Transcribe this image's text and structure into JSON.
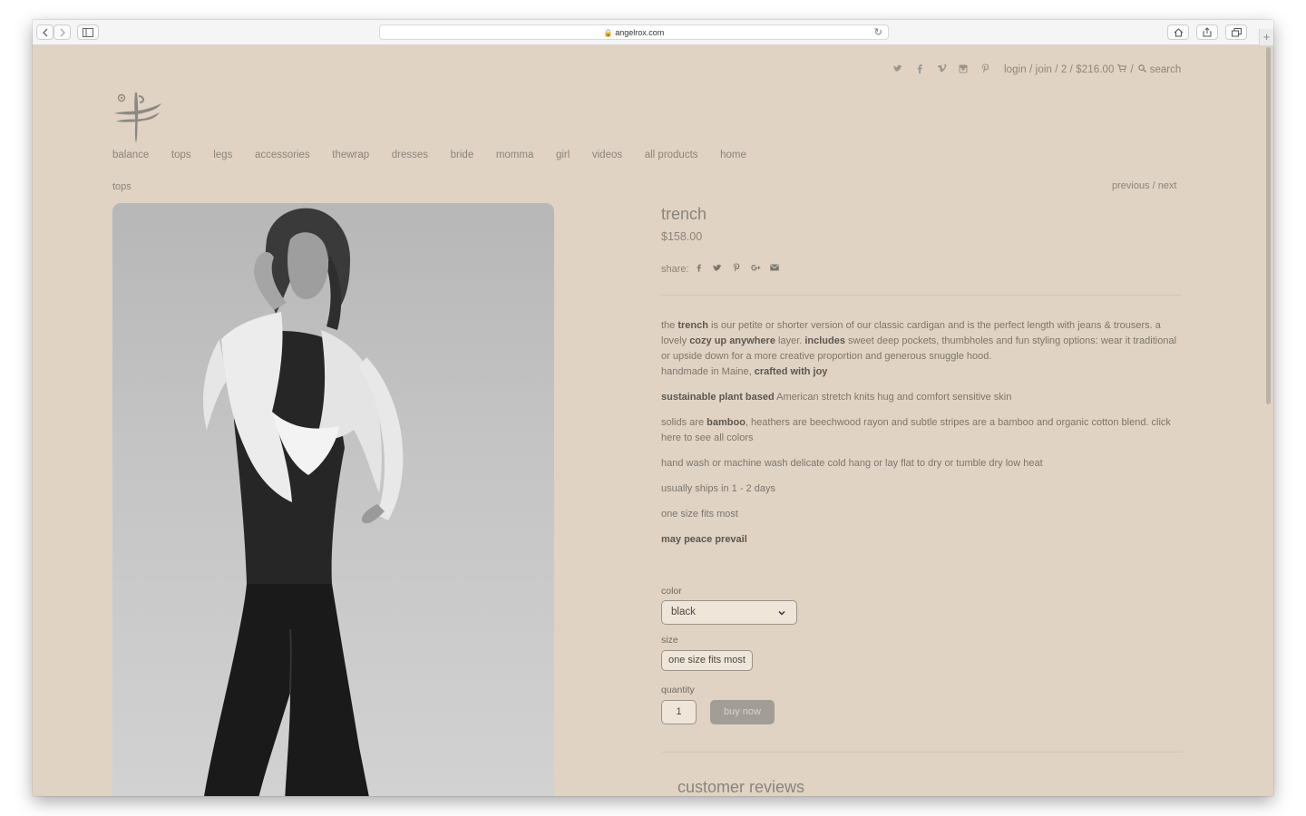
{
  "browser": {
    "url": "angelrox.com",
    "lock_icon": "lock-icon",
    "back_icon": "chevron-left-icon",
    "forward_icon": "chevron-right-icon",
    "sidebar_icon": "sidebar-icon",
    "reload_icon": "reload-icon",
    "home_icon": "home-icon",
    "share_icon": "share-icon",
    "tabs_icon": "tabs-icon",
    "new_tab": "+"
  },
  "header": {
    "social_icons": [
      "twitter-icon",
      "facebook-icon",
      "vimeo-icon",
      "instagram-icon",
      "pinterest-icon"
    ],
    "account_text": "login / join / 2 / $216.00",
    "cart_icon": "cart-icon",
    "separator": "/",
    "search_label": "search"
  },
  "nav": {
    "items": [
      "balance",
      "tops",
      "legs",
      "accessories",
      "thewrap",
      "dresses",
      "bride",
      "momma",
      "girl",
      "videos",
      "all products",
      "home"
    ]
  },
  "breadcrumb": "tops",
  "pager": "previous / next",
  "product": {
    "title": "trench",
    "price": "$158.00",
    "share_label": "share:",
    "share_icons": [
      "facebook-icon",
      "twitter-icon",
      "pinterest-icon",
      "google-plus-icon",
      "email-icon"
    ],
    "desc": {
      "p1_a": "the ",
      "p1_b": "trench",
      "p1_c": " is our petite or shorter version of our classic cardigan and is the perfect length with jeans & trousers.  a lovely ",
      "p1_d": "cozy up anywhere",
      "p1_e": " layer. ",
      "p1_f": "includes",
      "p1_g": " sweet deep pockets, thumbholes and fun styling options: wear it traditional or upside down for a more creative proportion and generous snuggle hood.",
      "p1_h": "handmade in Maine, ",
      "p1_i": "crafted with joy",
      "p2_a": "sustainable plant based",
      "p2_b": " American stretch knits hug and comfort sensitive skin",
      "p3_a": "solids are ",
      "p3_b": "bamboo",
      "p3_c": ", heathers are beechwood rayon and subtle stripes are a bamboo and organic cotton blend. click here to see all colors",
      "p4": "hand wash or machine wash delicate cold hang or lay flat to dry or tumble dry low heat",
      "p5": "usually ships in 1 - 2 days",
      "p6": "one size fits most",
      "p7": "may peace prevail"
    },
    "color_label": "color",
    "color_value": "black",
    "size_label": "size",
    "size_value": "one size fits most",
    "quantity_label": "quantity",
    "quantity_value": "1",
    "buy_label": "buy now",
    "reviews_heading": "customer reviews"
  }
}
